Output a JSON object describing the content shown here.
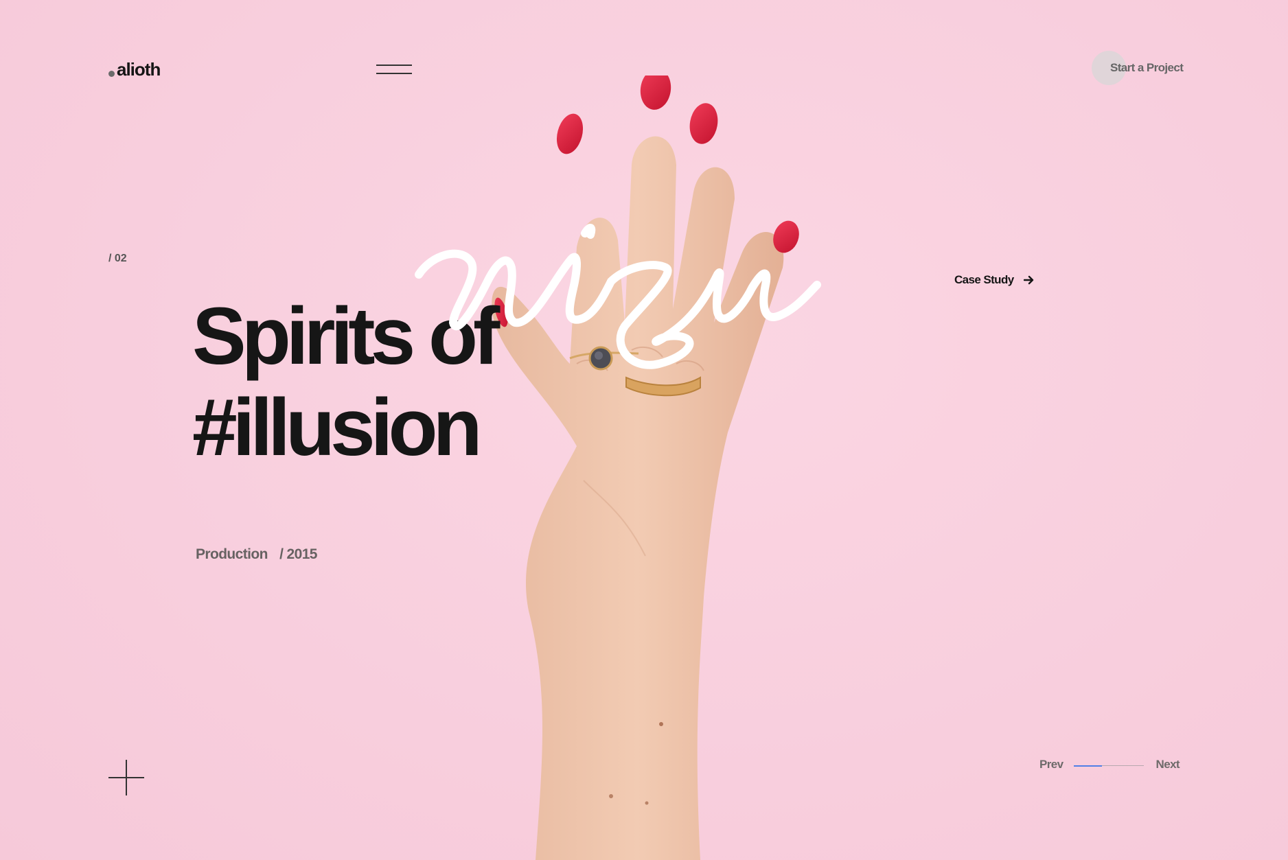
{
  "brand": {
    "name": "alioth"
  },
  "header": {
    "cta_label": "Start a Project"
  },
  "slide": {
    "counter": "/ 02",
    "title_line1": "Spirits of",
    "title_line2": "#illusion",
    "script_word": "wizu",
    "category": "Production",
    "year": "/ 2015",
    "case_study_label": "Case Study"
  },
  "pager": {
    "prev_label": "Prev",
    "next_label": "Next",
    "progress": 0.4
  },
  "colors": {
    "background": "#f9cfdf",
    "accent": "#4f7fe6",
    "nail": "#d81f3f",
    "text": "#161616"
  },
  "icons": {
    "menu": "hamburger-icon",
    "arrow": "arrow-right-icon",
    "plus": "plus-icon"
  }
}
